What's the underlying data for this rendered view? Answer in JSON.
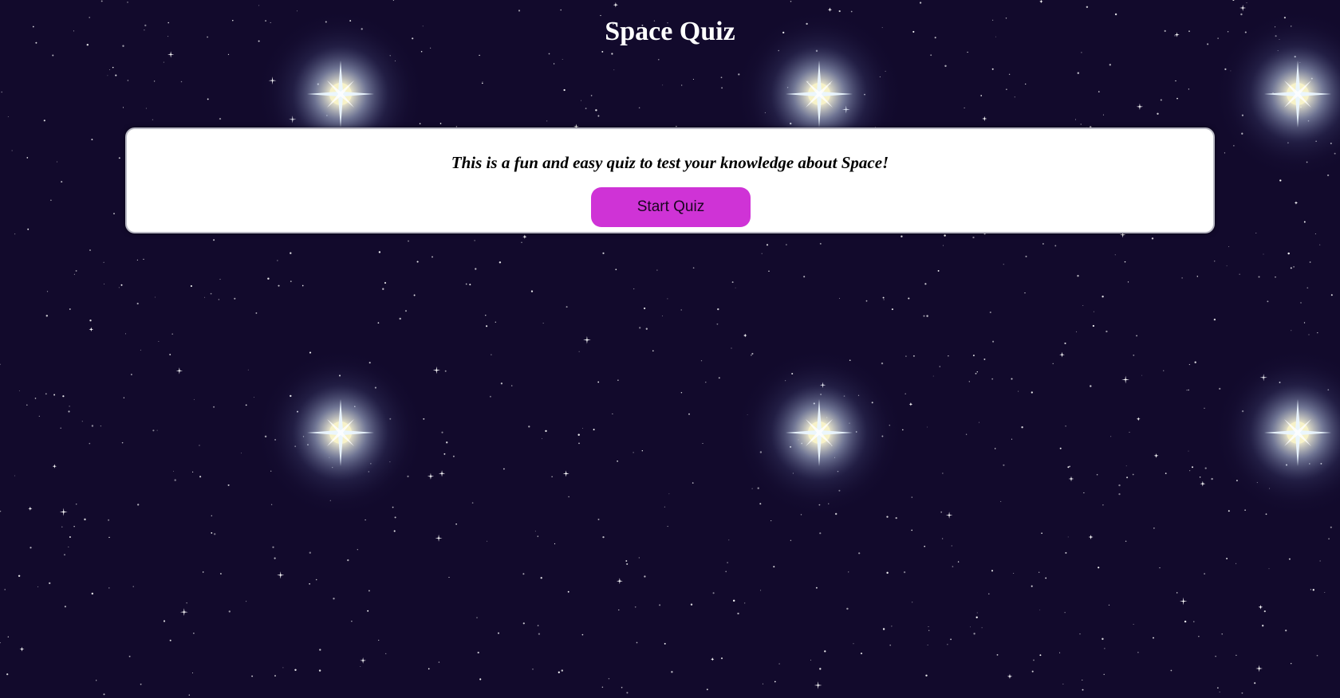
{
  "page": {
    "title": "Space Quiz",
    "background_color": "#120a2c",
    "background_icon": "starfield-background"
  },
  "quiz_card": {
    "intro_text": "This is a fun and easy quiz to test your knowledge about Space!",
    "start_button_label": "Start Quiz",
    "start_button_color": "#cf33d6",
    "card_color": "#ffffff"
  }
}
